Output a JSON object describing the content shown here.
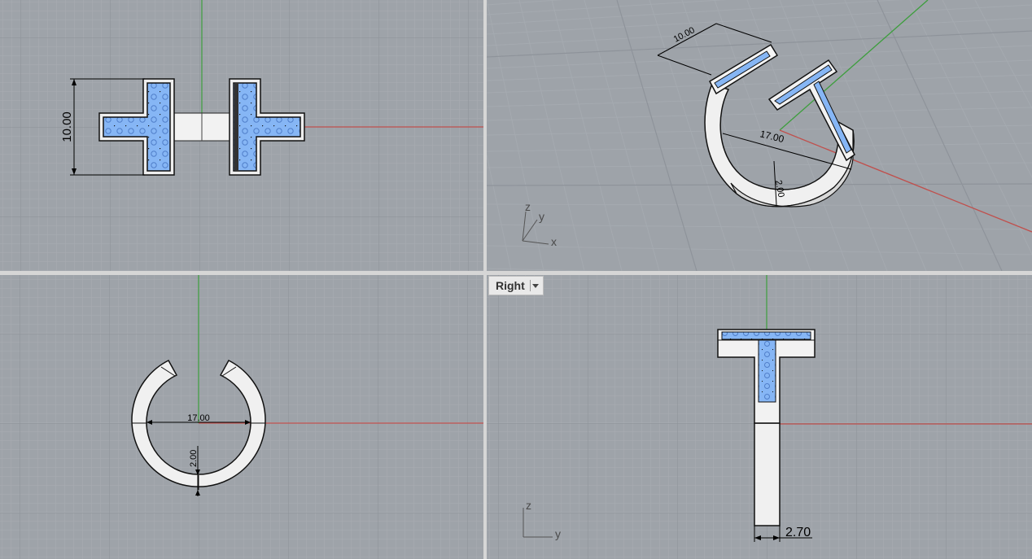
{
  "viewports": {
    "top": {
      "dim_height": "10.00"
    },
    "perspective": {
      "dim_width": "10.00",
      "dim_diameter": "17.00",
      "dim_thickness": "2.00",
      "axis_z": "z",
      "axis_y": "y",
      "axis_x": "x"
    },
    "front": {
      "dim_diameter": "17.00",
      "dim_thickness": "2.00"
    },
    "right": {
      "label": "Right",
      "dim_width": "2.70",
      "axis_z": "z",
      "axis_y": "y"
    }
  },
  "colors": {
    "viewport_bg": "#9ea3a9",
    "grid_minor": "#a9aeb3",
    "grid_major": "#8a8f95",
    "x_axis": "#c0504d",
    "y_axis": "#3d9e3d",
    "gem": "#86b6f5",
    "metal": "#f0f0f0"
  }
}
